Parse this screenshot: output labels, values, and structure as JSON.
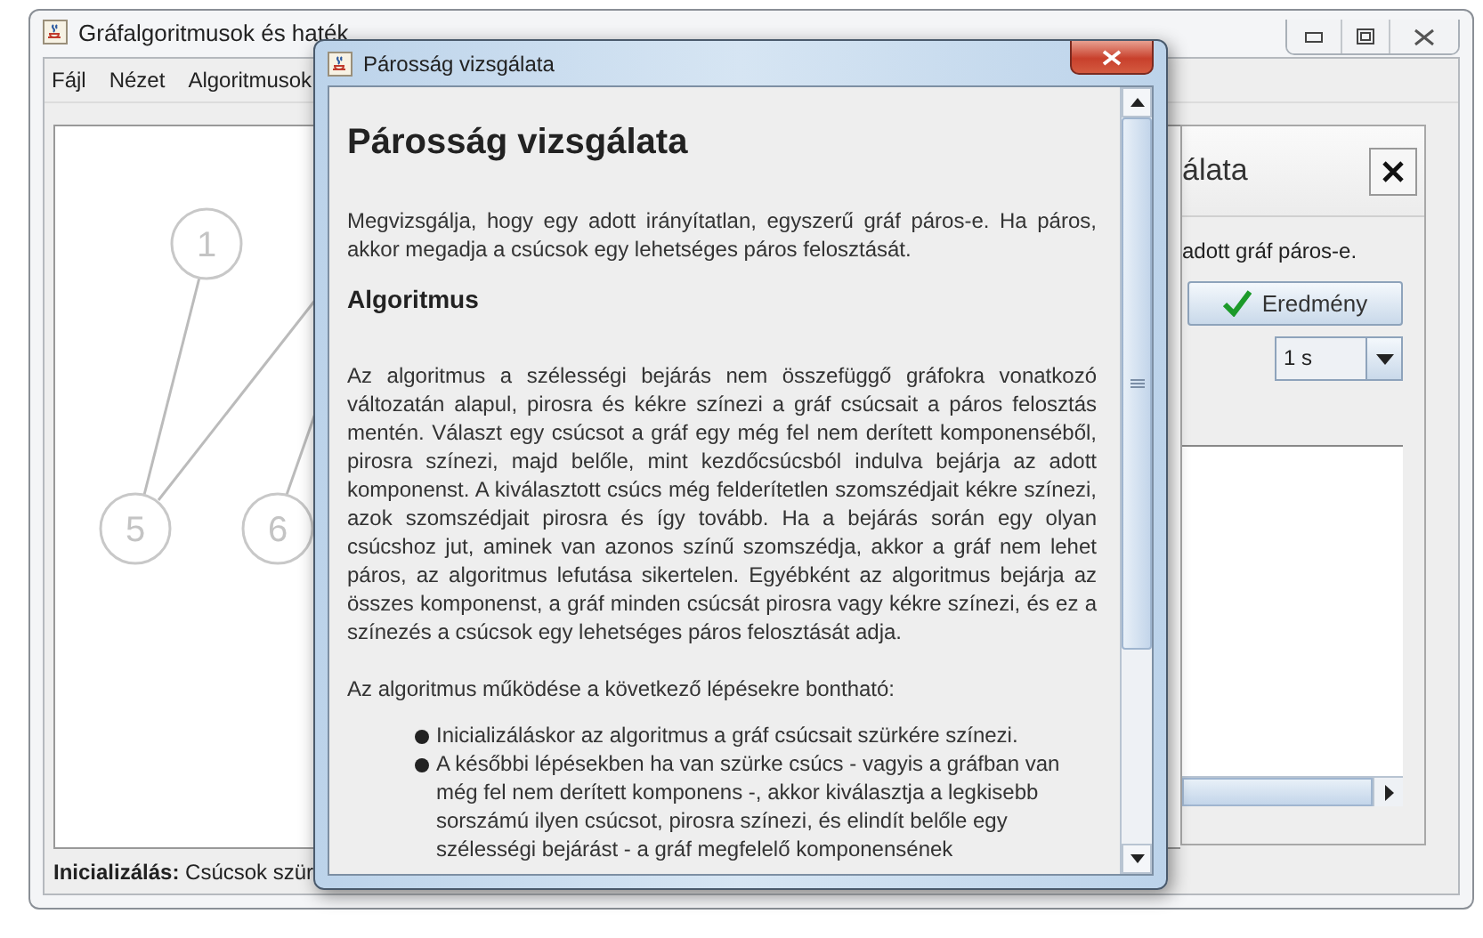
{
  "main_window": {
    "title": "Gráfalgoritmusok és haték",
    "menu": [
      "Fájl",
      "Nézet",
      "Algoritmusok"
    ],
    "graph": {
      "nodes": [
        {
          "label": "1"
        },
        {
          "label": "5"
        },
        {
          "label": "6"
        }
      ]
    },
    "side_panel": {
      "title": "álata",
      "description": "adott gráf páros-e.",
      "result_button": "Eredmény",
      "speed": "1 s"
    },
    "status": "**Inicializálás:** Csúcsok szür"
  },
  "dialog": {
    "title": "Párosság vizsgálata",
    "heading": "Párosság vizsgálata",
    "intro": "Megvizsgálja, hogy egy adott irányítatlan, egyszerű gráf páros-e. Ha páros, akkor megadja a csúcsok egy lehetséges páros felosztását.",
    "subheading": "Algoritmus",
    "paragraph": "Az algoritmus a szélességi bejárás nem összefüggő gráfokra vonatkozó változatán alapul, pirosra és kékre színezi a gráf csúcsait a páros felosztás mentén. Választ egy csúcsot a gráf egy még fel nem derített komponenséből, pirosra színezi, majd belőle, mint kezdőcsúcsból indulva bejárja az adott komponenst. A kiválasztott csúcs még felderítetlen szomszédjait kékre színezi, azok szomszédjait pirosra és így tovább. Ha a bejárás során egy olyan csúcshoz jut, aminek van azonos színű szomszédja, akkor a gráf nem lehet páros, az algoritmus lefutása sikertelen. Egyébként az algoritmus bejárja az összes komponenst, a gráf minden csúcsát pirosra vagy kékre színezi, és ez a színezés a csúcsok egy lehetséges páros felosztását adja.",
    "steps_intro": "Az algoritmus működése a következő lépésekre bontható:",
    "steps": [
      "Inicializáláskor az algoritmus a gráf csúcsait szürkére színezi.",
      "A későbbi lépésekben ha van szürke csúcs - vagyis a gráfban van még fel nem derített komponens -, akkor kiválasztja a legkisebb sorszámú ilyen csúcsot, pirosra színezi, és elindít belőle egy szélességi bejárást - a gráf megfelelő komponensének"
    ]
  }
}
